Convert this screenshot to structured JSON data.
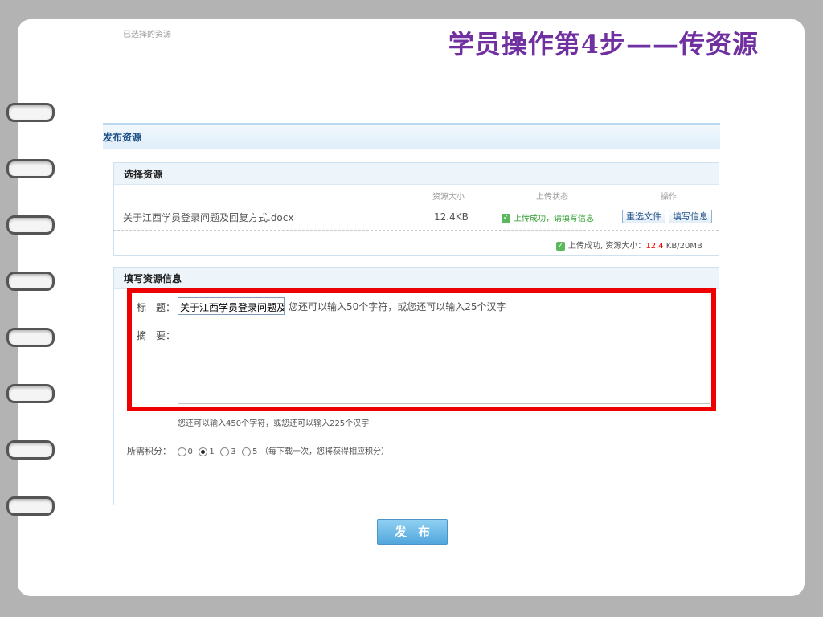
{
  "slide": {
    "title": "学员操作第4步——传资源"
  },
  "panel": {
    "title": "发布资源"
  },
  "select_section": {
    "heading": "选择资源",
    "columns": [
      "已选择的资源",
      "资源大小",
      "上传状态",
      "操作"
    ],
    "file": {
      "name": "关于江西学员登录问题及回复方式.docx",
      "size": "12.4KB",
      "status": "上传成功，请填写信息",
      "actions": [
        "重选文件",
        "填写信息"
      ]
    },
    "summary_prefix": "上传成功, 资源大小：",
    "summary_used": "12.4",
    "summary_total": " KB/20MB"
  },
  "info_section": {
    "heading": "填写资源信息",
    "title_label": "标　题：",
    "title_value": "关于江西学员登录问题及",
    "title_hint": "您还可以输入50个字符，或您还可以输入25个汉字",
    "summary_label": "摘　要：",
    "summary_value": "",
    "summary_hint": "您还可以输入450个字符，或您还可以输入225个汉字",
    "points_label": "所需积分：",
    "points_options": [
      "0",
      "1",
      "3",
      "5"
    ],
    "points_selected": "1",
    "points_note": "（每下载一次，您将获得相应积分）"
  },
  "publish_button": "发布",
  "colors": {
    "title_purple": "#7030a0",
    "highlight_red": "#ee0000",
    "success_green": "#5cb85c"
  }
}
